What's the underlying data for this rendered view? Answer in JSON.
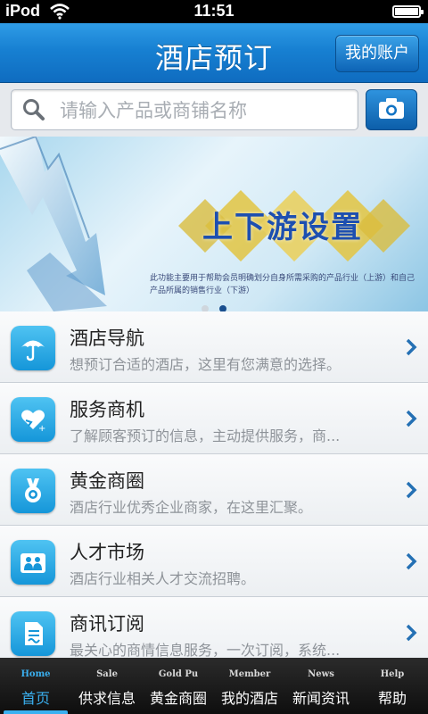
{
  "status_bar": {
    "carrier": "iPod",
    "time": "11:51"
  },
  "header": {
    "title": "酒店预订",
    "account_button": "我的账户"
  },
  "search": {
    "placeholder": "请输入产品或商铺名称",
    "value": ""
  },
  "banner": {
    "title": "上下游设置",
    "description": "此功能主要用于帮助会员明确划分自身所需采购的产品行业（上游）和自己产品所属的销售行业（下游）",
    "page_count": 2,
    "active_page": 2
  },
  "list": [
    {
      "icon": "umbrella-icon",
      "title": "酒店导航",
      "subtitle": "想预订合适的酒店，这里有您满意的选择。"
    },
    {
      "icon": "heart-icon",
      "title": "服务商机",
      "subtitle": "了解顾客预订的信息，主动提供服务，商..."
    },
    {
      "icon": "medal-icon",
      "title": "黄金商圈",
      "subtitle": "酒店行业优秀企业商家，在这里汇聚。"
    },
    {
      "icon": "people-icon",
      "title": "人才市场",
      "subtitle": "酒店行业相关人才交流招聘。"
    },
    {
      "icon": "document-icon",
      "title": "商讯订阅",
      "subtitle": "最关心的商情信息服务，一次订阅，系统..."
    }
  ],
  "tabs": [
    {
      "en": "Home",
      "cn": "首页",
      "active": true
    },
    {
      "en": "Sale",
      "cn": "供求信息",
      "active": false
    },
    {
      "en": "Gold Pu",
      "cn": "黄金商圈",
      "active": false
    },
    {
      "en": "Member",
      "cn": "我的酒店",
      "active": false
    },
    {
      "en": "News",
      "cn": "新闻资讯",
      "active": false
    },
    {
      "en": "Help",
      "cn": "帮助",
      "active": false
    }
  ],
  "colors": {
    "accent": "#1780d2",
    "tab_active": "#3ab0f0",
    "icon_bg": "#1596d9"
  }
}
